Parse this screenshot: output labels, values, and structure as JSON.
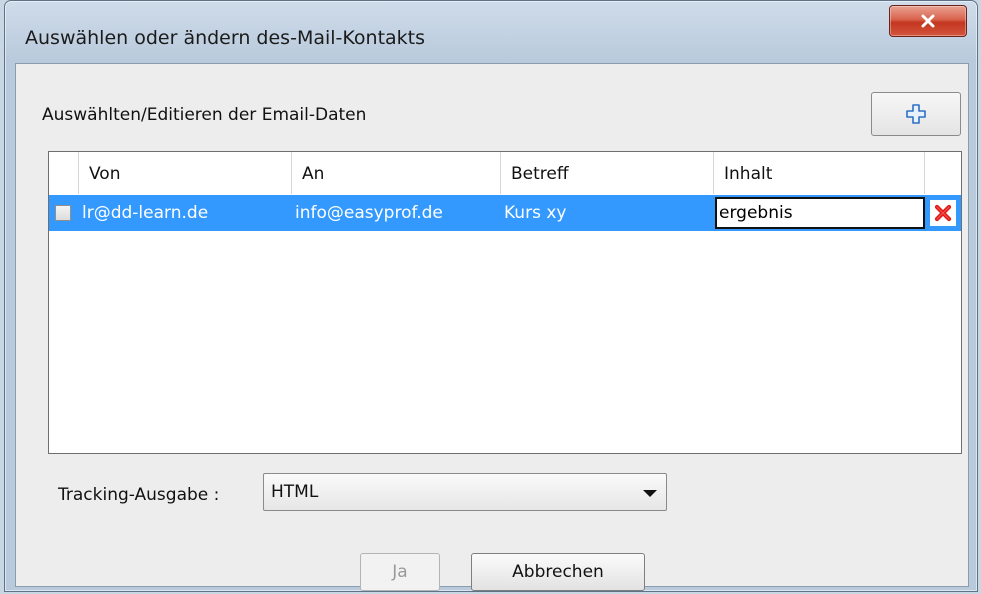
{
  "window": {
    "title": "Auswählen oder ändern des-Mail-Kontakts",
    "close_icon": "close-icon"
  },
  "email_section": {
    "label": "Auswählten/Editieren der Email-Daten",
    "add_icon": "plus-icon"
  },
  "table": {
    "columns": [
      "Von",
      "An",
      "Betreff",
      "Inhalt"
    ],
    "rows": [
      {
        "checked": false,
        "von": "lr@dd-learn.de",
        "an": "info@easyprof.de",
        "betreff": "Kurs xy",
        "inhalt": "ergebnis",
        "delete_icon": "delete-icon"
      }
    ],
    "selected_row_color": "#3399ff"
  },
  "tracking": {
    "label": "Tracking-Ausgabe :",
    "selected": "HTML"
  },
  "buttons": {
    "ok_label": "Ja",
    "cancel_label": "Abbrechen"
  }
}
